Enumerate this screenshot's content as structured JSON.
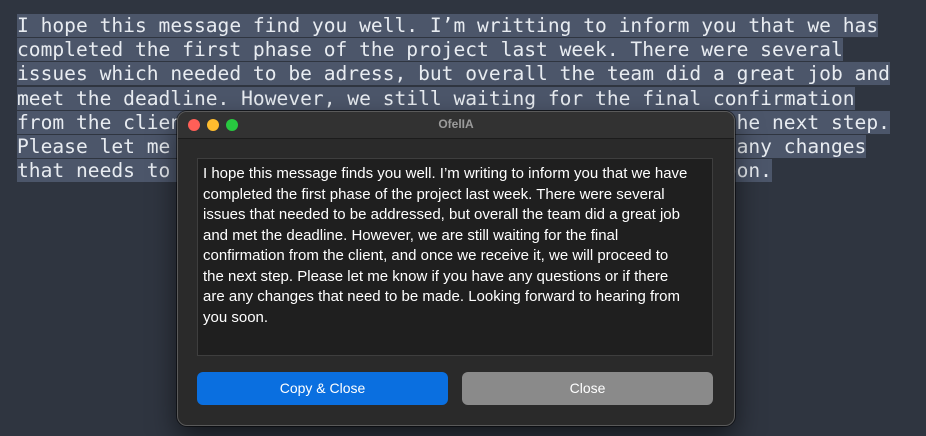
{
  "editor": {
    "lines": [
      "I hope this message find you well. I’m writting to inform you that we has",
      "completed the first phase of the project last week. There were several",
      "issues which needed to be adress, but overall the team did a great job and",
      "meet the deadline. However, we still waiting for the final confirmation",
      "from the client, and once we receive it, we will proceed to the next step.",
      "Please let me know if you have any questions or if there are any changes",
      "that needs to be made. Looking forward to hearing from you soon."
    ]
  },
  "dialog": {
    "title": "OfelIA",
    "text_lines": [
      "I hope this message finds you well. I’m writing to inform you that we have",
      "completed the first phase of the project last week. There were several",
      "issues that needed to be addressed, but overall the team did a great job",
      "and met the deadline. However, we are still waiting for the final",
      "confirmation from the client, and once we receive it, we will proceed to",
      "the next step. Please let me know if you have any questions or if there",
      "are any changes that need to be made. Looking forward to hearing from",
      "you soon."
    ],
    "copy_close_label": "Copy & Close",
    "close_label": "Close"
  },
  "colors": {
    "editor_background": "#2f3540",
    "selection": "#4c566a",
    "primary_button": "#0a6fe0",
    "secondary_button": "#8a8a8a",
    "traffic_close": "#ff5f57",
    "traffic_minimize": "#febc2e",
    "traffic_zoom": "#28c840"
  }
}
